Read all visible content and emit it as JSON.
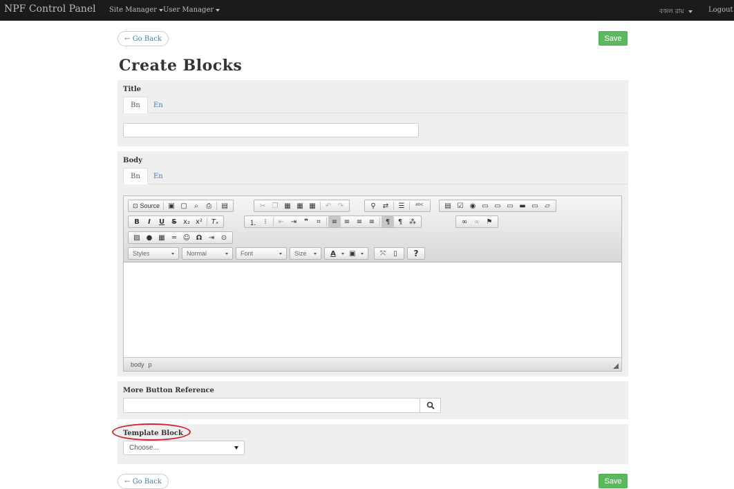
{
  "navbar": {
    "brand": "NPF Control Panel",
    "site_manager": "Site Manager",
    "user_manager": "User Manager",
    "user_name": "বজল রায়",
    "logout": "Logout"
  },
  "actions": {
    "back_label": "← Go Back",
    "save_label": "Save"
  },
  "page": {
    "title": "Create Blocks"
  },
  "title_section": {
    "label": "Title",
    "tabs": [
      "Bn",
      "En"
    ],
    "active_tab": "Bn",
    "value": ""
  },
  "body_section": {
    "label": "Body",
    "tabs": [
      "Bn",
      "En"
    ],
    "active_tab": "Bn",
    "toolbar": {
      "source_label": "Source",
      "styles_label": "Styles",
      "format_label": "Normal",
      "font_label": "Font",
      "size_label": "Size",
      "help_label": "?"
    },
    "status_path": [
      "body",
      "p"
    ]
  },
  "more_button_section": {
    "label": "More Button Reference",
    "value": "",
    "search_icon": "search-icon"
  },
  "template_section": {
    "label": "Template Block",
    "selected": "Choose..."
  },
  "colors": {
    "navbar_bg": "#1b1b1b",
    "save_green": "#5cb85c",
    "link_blue": "#4a78a8",
    "highlight_red": "#d8202c",
    "panel_bg": "#efefef"
  }
}
